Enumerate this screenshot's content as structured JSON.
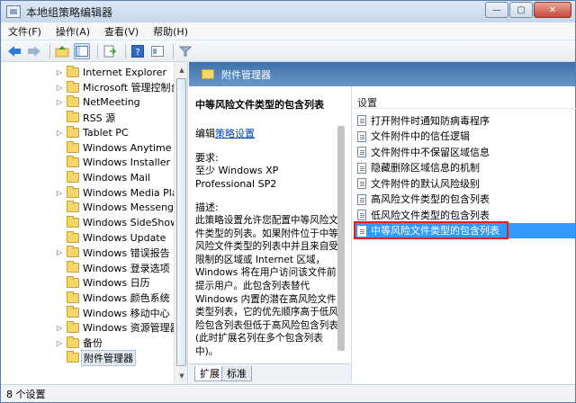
{
  "window": {
    "title": "本地组策略编辑器",
    "minimize_glyph": "—",
    "maximize_glyph": "▢",
    "close_glyph": "✕"
  },
  "menu": [
    "文件(F)",
    "操作(A)",
    "查看(V)",
    "帮助(H)"
  ],
  "toolbar": {
    "icons": [
      "back-arrow-icon",
      "forward-arrow-icon",
      "up-folder-icon",
      "show-hide-tree-icon",
      "export-list-icon",
      "help-icon",
      "properties-icon",
      "filter-icon"
    ]
  },
  "tree": {
    "items": [
      {
        "label": "Internet Explorer",
        "has_children": true
      },
      {
        "label": "Microsoft 管理控制台",
        "has_children": true
      },
      {
        "label": "NetMeeting",
        "has_children": true
      },
      {
        "label": "RSS 源",
        "has_children": false
      },
      {
        "label": "Tablet PC",
        "has_children": true
      },
      {
        "label": "Windows Anytime Up",
        "has_children": false
      },
      {
        "label": "Windows Installer",
        "has_children": false
      },
      {
        "label": "Windows Mail",
        "has_children": false
      },
      {
        "label": "Windows Media Play",
        "has_children": true
      },
      {
        "label": "Windows Messenger",
        "has_children": false
      },
      {
        "label": "Windows SideShow",
        "has_children": false
      },
      {
        "label": "Windows Update",
        "has_children": false
      },
      {
        "label": "Windows 错误报告",
        "has_children": true
      },
      {
        "label": "Windows 登录选项",
        "has_children": false
      },
      {
        "label": "Windows 日历",
        "has_children": false
      },
      {
        "label": "Windows 颜色系统",
        "has_children": false
      },
      {
        "label": "Windows 移动中心",
        "has_children": false
      },
      {
        "label": "Windows 资源管理器",
        "has_children": true
      },
      {
        "label": "备份",
        "has_children": true
      },
      {
        "label": "附件管理器",
        "has_children": false,
        "selected": true
      }
    ]
  },
  "right_header": {
    "title": "附件管理器"
  },
  "description": {
    "title": "中等风险文件类型的包含列表",
    "edit_prefix": "编辑",
    "edit_link": "策略设置",
    "requirements_heading": "要求:",
    "requirements": "至少 Windows XP Professional SP2",
    "description_heading": "描述:",
    "body": "此策略设置允许您配置中等风险文件类型的列表。如果附件位于中等风险文件类型的列表中并且来自受限制的区域或 Internet 区域，Windows 将在用户访问该文件前提示用户。此包含列表替代 Windows 内置的潜在高风险文件类型列表，它的优先顺序高于低风险包含列表但低于高风险包含列表(此时扩展名列在多个包含列表中)。"
  },
  "settings": {
    "header": "设置",
    "items": [
      {
        "label": "打开附件时通知防病毒程序"
      },
      {
        "label": "文件附件中的信任逻辑"
      },
      {
        "label": "文件附件中不保留区域信息"
      },
      {
        "label": "隐藏删除区域信息的机制"
      },
      {
        "label": "文件附件的默认风险级别"
      },
      {
        "label": "高风险文件类型的包含列表"
      },
      {
        "label": "低风险文件类型的包含列表"
      },
      {
        "label": "中等风险文件类型的包含列表",
        "selected": true
      }
    ]
  },
  "tabs": [
    {
      "label": "扩展",
      "active": true
    },
    {
      "label": "标准",
      "active": false
    }
  ],
  "status": {
    "text": "8 个设置"
  },
  "colors": {
    "selection": "#3399ff",
    "highlight_box": "#e02020",
    "header_gradient_top": "#3f71a8",
    "link": "#0645ad"
  }
}
